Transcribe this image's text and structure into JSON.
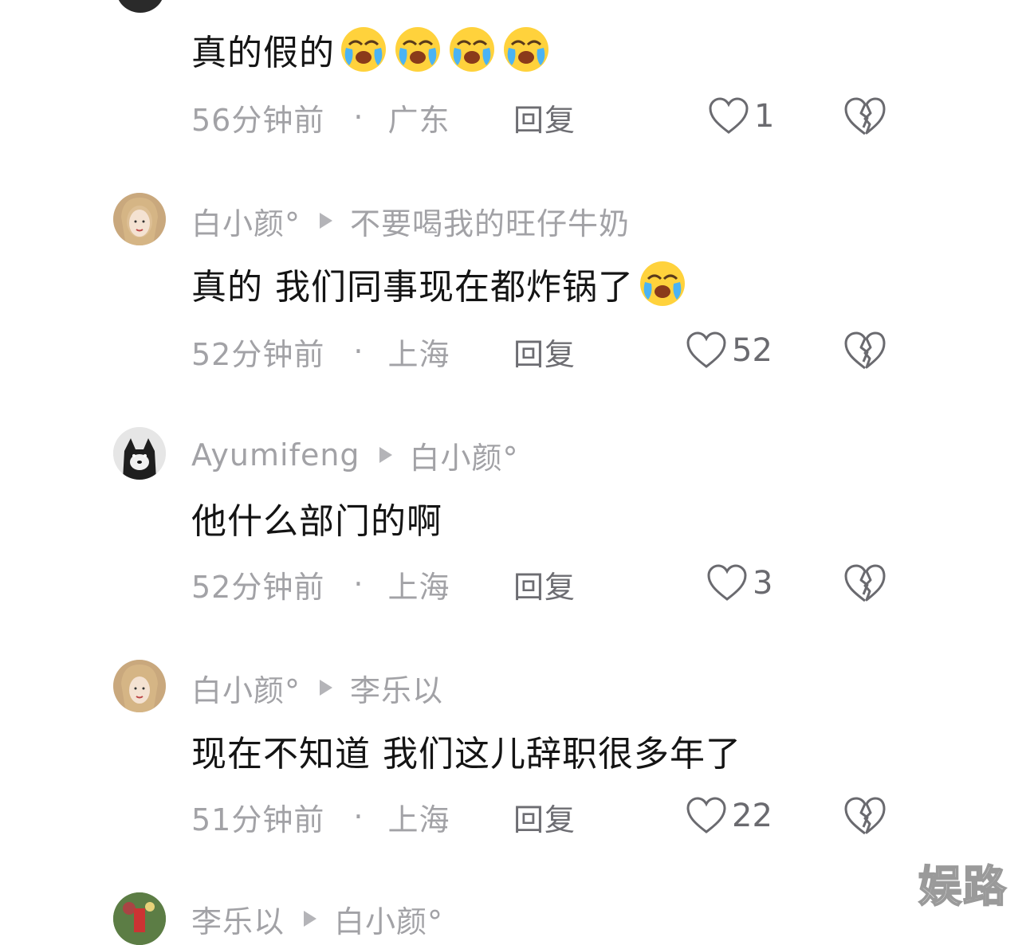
{
  "comments": [
    {
      "id": "c0",
      "text": "真的假的",
      "emojis": 4,
      "time": "56分钟前",
      "location": "广东",
      "reply_label": "回复",
      "likes": "1"
    },
    {
      "id": "c1",
      "author": "白小颜°",
      "reply_to": "不要喝我的旺仔牛奶",
      "text": "真的 我们同事现在都炸锅了",
      "emojis": 1,
      "time": "52分钟前",
      "location": "上海",
      "reply_label": "回复",
      "likes": "52"
    },
    {
      "id": "c2",
      "author": "Ayumifeng",
      "reply_to": "白小颜°",
      "text": "他什么部门的啊",
      "emojis": 0,
      "time": "52分钟前",
      "location": "上海",
      "reply_label": "回复",
      "likes": "3"
    },
    {
      "id": "c3",
      "author": "白小颜°",
      "reply_to": "李乐以",
      "text": "现在不知道 我们这儿辞职很多年了",
      "emojis": 0,
      "time": "51分钟前",
      "location": "上海",
      "reply_label": "回复",
      "likes": "22"
    },
    {
      "id": "c4",
      "author": "李乐以",
      "reply_to": "白小颜°"
    }
  ],
  "separator": "·",
  "watermark": "娱路",
  "colors": {
    "text": "#141414",
    "muted": "#a2a2a6",
    "action": "#6d6d72"
  }
}
